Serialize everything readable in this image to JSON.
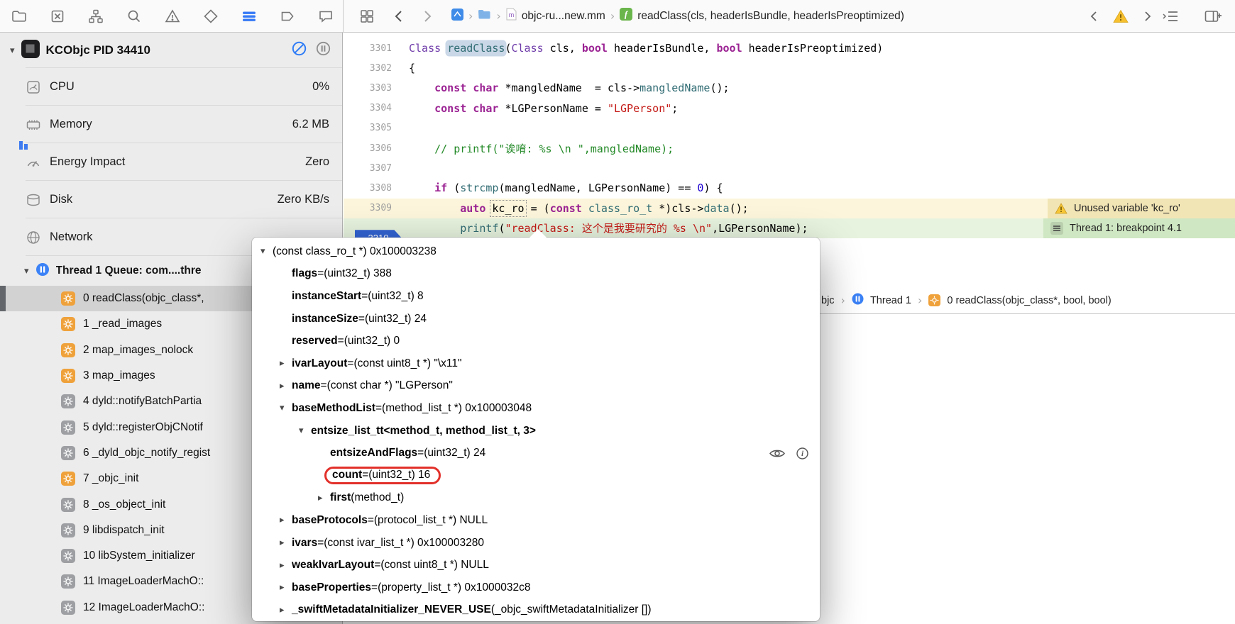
{
  "colors": {
    "accent_blue": "#3478F6",
    "thread_blue": "#3B82F7",
    "breakpoint_badge_blue": "#3163D2",
    "warning_yellow": "#F6C02E",
    "annotation_red_circle": "#E2302A",
    "frame_orange": "#EFA23B",
    "frame_gray": "#9D9FA3",
    "stopped_line_green": "#E7F3DE",
    "warning_line_yellow": "#FCF5DB"
  },
  "toolbar": {
    "breadcrumb": {
      "file": "objc-ru...new.mm",
      "symbol": "readClass(cls, headerIsBundle, headerIsPreoptimized)"
    }
  },
  "sidebar": {
    "process": {
      "name": "KCObjc PID 34410"
    },
    "gauges": [
      {
        "id": "cpu",
        "label": "CPU",
        "value": "0%"
      },
      {
        "id": "memory",
        "label": "Memory",
        "value": "6.2 MB"
      },
      {
        "id": "energy",
        "label": "Energy Impact",
        "value": "Zero"
      },
      {
        "id": "disk",
        "label": "Disk",
        "value": "Zero KB/s"
      },
      {
        "id": "network",
        "label": "Network",
        "value": ""
      }
    ],
    "thread": {
      "label": "Thread 1 Queue: com....thre"
    },
    "frames": [
      {
        "text": "0 readClass(objc_class*,",
        "color": "orange",
        "selected": true
      },
      {
        "text": "1 _read_images",
        "color": "orange"
      },
      {
        "text": "2 map_images_nolock",
        "color": "orange"
      },
      {
        "text": "3 map_images",
        "color": "orange"
      },
      {
        "text": "4 dyld::notifyBatchPartia",
        "color": "gray"
      },
      {
        "text": "5 dyld::registerObjCNotif",
        "color": "gray"
      },
      {
        "text": "6 _dyld_objc_notify_regist",
        "color": "gray"
      },
      {
        "text": "7 _objc_init",
        "color": "orange"
      },
      {
        "text": "8 _os_object_init",
        "color": "gray"
      },
      {
        "text": "9 libdispatch_init",
        "color": "gray"
      },
      {
        "text": "10 libSystem_initializer",
        "color": "gray"
      },
      {
        "text": "11 ImageLoaderMachO::",
        "color": "gray"
      },
      {
        "text": "12 ImageLoaderMachO::",
        "color": "gray"
      }
    ]
  },
  "editor": {
    "lines": [
      {
        "n": "3301",
        "tokens": [
          [
            "Class ",
            "type"
          ],
          [
            "readClass",
            "func hl"
          ],
          [
            "(",
            "plain"
          ],
          [
            "Class",
            "type"
          ],
          [
            " cls, ",
            "plain"
          ],
          [
            "bool",
            "kw"
          ],
          [
            " headerIsBundle, ",
            "plain"
          ],
          [
            "bool",
            "kw"
          ],
          [
            " headerIsPreoptimized)",
            "plain"
          ]
        ]
      },
      {
        "n": "3302",
        "tokens": [
          [
            "{",
            "plain"
          ]
        ]
      },
      {
        "n": "3303",
        "tokens": [
          [
            "    ",
            "plain"
          ],
          [
            "const",
            "kw"
          ],
          [
            " ",
            "plain"
          ],
          [
            "char",
            "kw"
          ],
          [
            " *mangledName  = cls->",
            "plain"
          ],
          [
            "mangledName",
            "func"
          ],
          [
            "();",
            "plain"
          ]
        ]
      },
      {
        "n": "3304",
        "tokens": [
          [
            "    ",
            "plain"
          ],
          [
            "const",
            "kw"
          ],
          [
            " ",
            "plain"
          ],
          [
            "char",
            "kw"
          ],
          [
            " *LGPersonName = ",
            "plain"
          ],
          [
            "\"LGPerson\"",
            "str"
          ],
          [
            ";",
            "plain"
          ]
        ]
      },
      {
        "n": "3305",
        "tokens": []
      },
      {
        "n": "3306",
        "tokens": [
          [
            "    ",
            "plain"
          ],
          [
            "// printf(\"诶唷: %s \\n \",mangledName);",
            "comment"
          ]
        ]
      },
      {
        "n": "3307",
        "tokens": []
      },
      {
        "n": "3308",
        "tokens": [
          [
            "    ",
            "plain"
          ],
          [
            "if",
            "kw"
          ],
          [
            " (",
            "plain"
          ],
          [
            "strcmp",
            "func"
          ],
          [
            "(mangledName, LGPersonName) == ",
            "plain"
          ],
          [
            "0",
            "num"
          ],
          [
            ") {",
            "plain"
          ]
        ]
      },
      {
        "n": "3309",
        "kind": "warning",
        "ann": "Unused variable 'kc_ro'",
        "tokens": [
          [
            "        ",
            "plain"
          ],
          [
            "auto",
            "kw"
          ],
          [
            " ",
            "plain"
          ],
          [
            "kc_ro",
            "plain anchor"
          ],
          [
            " = (",
            "plain"
          ],
          [
            "const",
            "kw"
          ],
          [
            " ",
            "plain"
          ],
          [
            "class_ro_t",
            "func"
          ],
          [
            " *)cls->",
            "plain"
          ],
          [
            "data",
            "func"
          ],
          [
            "();",
            "plain"
          ]
        ]
      },
      {
        "n": "3310",
        "kind": "breakpoint",
        "ann": "Thread 1: breakpoint 4.1",
        "tokens": [
          [
            "        ",
            "plain"
          ],
          [
            "printf",
            "func"
          ],
          [
            "(",
            "plain"
          ],
          [
            "\"readClass: 这个是我要研究的 %s \\n\"",
            "str"
          ],
          [
            ",LGPersonName);",
            "plain"
          ]
        ]
      }
    ]
  },
  "debug_bar": {
    "prefix": "bjc",
    "thread": "Thread 1",
    "frame": "0 readClass(objc_class*, bool, bool)"
  },
  "popover": {
    "rows": [
      {
        "indent": 0,
        "disc": "down",
        "name": "",
        "eq": false,
        "value": "(const class_ro_t *) 0x100003238"
      },
      {
        "indent": 1,
        "disc": "",
        "name": "flags",
        "eq": true,
        "value": "(uint32_t) 388"
      },
      {
        "indent": 1,
        "disc": "",
        "name": "instanceStart",
        "eq": true,
        "value": "(uint32_t) 8"
      },
      {
        "indent": 1,
        "disc": "",
        "name": "instanceSize",
        "eq": true,
        "value": "(uint32_t) 24"
      },
      {
        "indent": 1,
        "disc": "",
        "name": "reserved",
        "eq": true,
        "value": "(uint32_t) 0"
      },
      {
        "indent": 1,
        "disc": "right",
        "name": "ivarLayout",
        "eq": true,
        "value": "(const uint8_t *) \"\\x11\""
      },
      {
        "indent": 1,
        "disc": "right",
        "name": "name",
        "eq": true,
        "value": "(const char *) \"LGPerson\""
      },
      {
        "indent": 1,
        "disc": "down",
        "name": "baseMethodList",
        "eq": true,
        "value": "(method_list_t *) 0x100003048"
      },
      {
        "indent": 2,
        "disc": "down",
        "name": "entsize_list_tt<method_t, method_list_t, 3>",
        "eq": false,
        "value": ""
      },
      {
        "indent": 3,
        "disc": "",
        "name": "entsizeAndFlags",
        "eq": true,
        "value": "(uint32_t) 24",
        "icons": true
      },
      {
        "indent": 3,
        "disc": "",
        "name": "count",
        "eq": true,
        "value": "(uint32_t) 16",
        "circled": true
      },
      {
        "indent": 3,
        "disc": "right",
        "name": "first",
        "eq": false,
        "value": "(method_t)"
      },
      {
        "indent": 1,
        "disc": "right",
        "name": "baseProtocols",
        "eq": true,
        "value": "(protocol_list_t *) NULL"
      },
      {
        "indent": 1,
        "disc": "right",
        "name": "ivars",
        "eq": true,
        "value": "(const ivar_list_t *) 0x100003280"
      },
      {
        "indent": 1,
        "disc": "right",
        "name": "weakIvarLayout",
        "eq": true,
        "value": "(const uint8_t *) NULL"
      },
      {
        "indent": 1,
        "disc": "right",
        "name": "baseProperties",
        "eq": true,
        "value": "(property_list_t *) 0x1000032c8"
      },
      {
        "indent": 1,
        "disc": "right",
        "name": "_swiftMetadataInitializer_NEVER_USE",
        "eq": false,
        "value": "(_objc_swiftMetadataInitializer [])"
      }
    ]
  }
}
